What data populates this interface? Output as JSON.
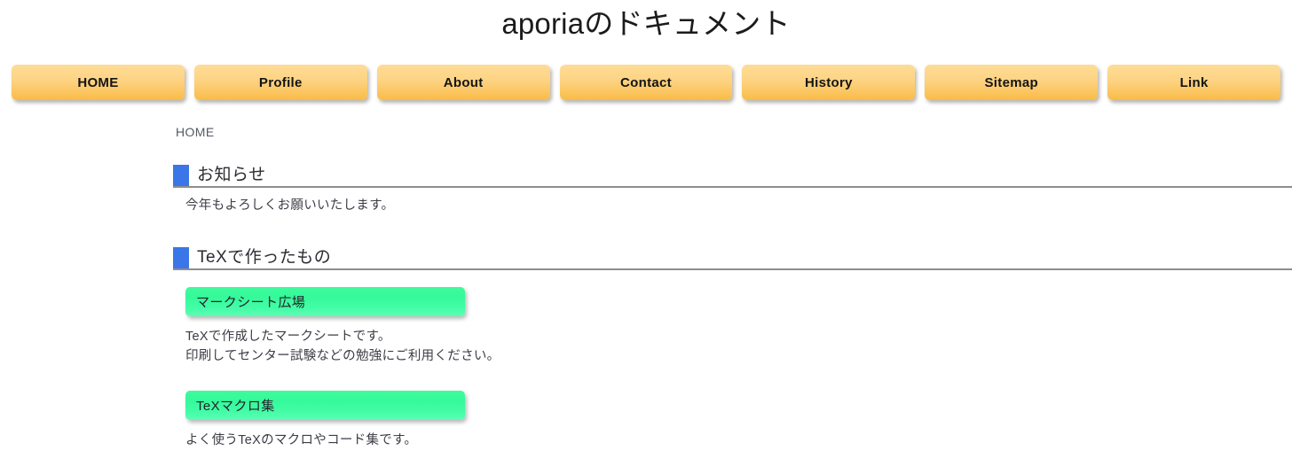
{
  "page": {
    "title": "aporiaのドキュメント"
  },
  "nav": {
    "items": [
      {
        "label": "HOME"
      },
      {
        "label": "Profile"
      },
      {
        "label": "About"
      },
      {
        "label": "Contact"
      },
      {
        "label": "History"
      },
      {
        "label": "Sitemap"
      },
      {
        "label": "Link"
      }
    ]
  },
  "breadcrumb": {
    "text": "HOME"
  },
  "sections": [
    {
      "title": "お知らせ",
      "marker_color": "#3b76e8",
      "paragraphs": [
        "今年もよろしくお願いいたします。"
      ]
    },
    {
      "title": "TeXで作ったもの",
      "marker_color": "#3b76e8",
      "links": [
        {
          "label": "マークシート広場",
          "description": [
            "TeXで作成したマークシートです。",
            "印刷してセンター試験などの勉強にご利用ください。"
          ]
        },
        {
          "label": "TeXマクロ集",
          "description": [
            "よく使うTeXのマクロやコード集です。"
          ]
        }
      ]
    }
  ],
  "colors": {
    "nav_button_top": "#fedc96",
    "nav_button_bottom": "#f9bb46",
    "green_button": "#3ffb9d",
    "marker_blue": "#3b76e8",
    "rule": "#8d8d8d",
    "body_text": "#3c3c46",
    "breadcrumb_text": "#555a63"
  }
}
